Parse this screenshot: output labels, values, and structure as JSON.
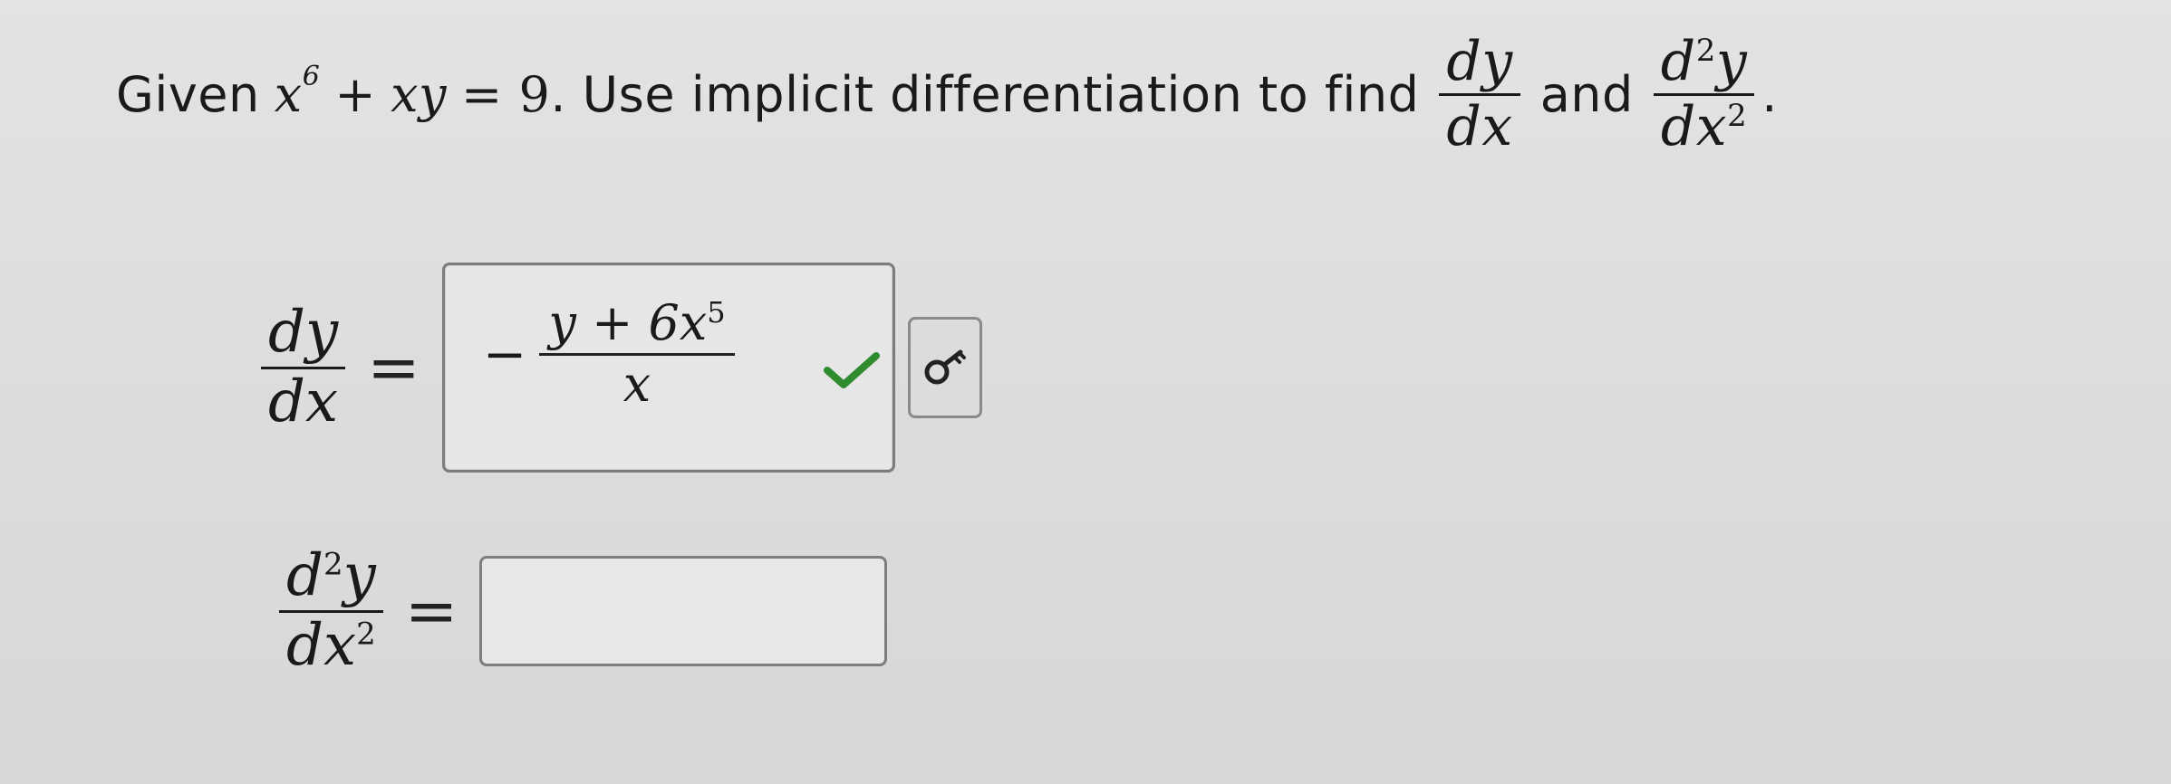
{
  "prompt": {
    "given": "Given",
    "x": "x",
    "exp6": "6",
    "plus": "+",
    "xy": "xy",
    "equals_nine": "= 9",
    "rest": ". Use implicit differentiation to find",
    "dy": "dy",
    "dx": "dx",
    "and": "and",
    "d2y_d": "d",
    "d2y_exp": "2",
    "d2y_y": "y",
    "dx2_dx": "dx",
    "dx2_exp": "2",
    "period": "."
  },
  "first_derivative": {
    "lhs_num": "dy",
    "lhs_den": "dx",
    "equals": "=",
    "answer": {
      "minus": "−",
      "num_main": "y + 6x",
      "num_exp": "5",
      "den": "x"
    },
    "status": "correct",
    "check_color": "#2e8b2e",
    "key_icon": "key-icon"
  },
  "second_derivative": {
    "lhs_num_d": "d",
    "lhs_num_exp": "2",
    "lhs_num_y": "y",
    "lhs_den_dx": "dx",
    "lhs_den_exp": "2",
    "equals": "=",
    "value": ""
  }
}
